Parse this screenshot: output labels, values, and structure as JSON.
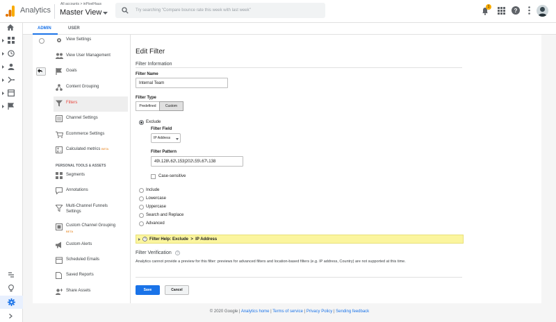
{
  "app": {
    "name": "Analytics",
    "breadcrumb": "All accounts > inPixelHaus",
    "view": "Master View",
    "search_placeholder": "Try searching \"Compare bounce rate this week with last week\"",
    "notification_count": "1"
  },
  "tabs": {
    "admin": "ADMIN",
    "user": "USER"
  },
  "nav": {
    "items": [
      {
        "label": "View Settings",
        "icon": "gear-icon"
      },
      {
        "label": "View User Management",
        "icon": "users-icon"
      },
      {
        "label": "Goals",
        "icon": "flag-icon"
      },
      {
        "label": "Content Grouping",
        "icon": "content-grouping-icon"
      },
      {
        "label": "Filters",
        "icon": "filter-icon"
      },
      {
        "label": "Channel Settings",
        "icon": "channel-icon"
      },
      {
        "label": "Ecommerce Settings",
        "icon": "cart-icon"
      },
      {
        "label": "Calculated metrics",
        "badge": "BETA",
        "icon": "calculator-icon"
      }
    ],
    "section_title": "PERSONAL TOOLS & ASSETS",
    "personal": [
      {
        "label": "Segments",
        "icon": "segments-icon"
      },
      {
        "label": "Annotations",
        "icon": "annotations-icon"
      },
      {
        "label": "Multi-Channel Funnels",
        "label2": "Settings",
        "icon": "funnel-icon"
      },
      {
        "label": "Custom Channel Grouping",
        "badge": "BETA",
        "icon": "grouping-icon"
      },
      {
        "label": "Custom Alerts",
        "icon": "megaphone-icon"
      },
      {
        "label": "Scheduled Emails",
        "icon": "schedule-icon"
      },
      {
        "label": "Saved Reports",
        "icon": "saved-reports-icon"
      },
      {
        "label": "Share Assets",
        "icon": "share-icon"
      }
    ],
    "active": "Filters"
  },
  "form": {
    "title": "Edit Filter",
    "section_info": "Filter Information",
    "name_label": "Filter Name",
    "name_value": "Internal Team",
    "type_label": "Filter Type",
    "type_predefined": "Predefined",
    "type_custom": "Custom",
    "options": {
      "exclude": "Exclude",
      "include": "Include",
      "lowercase": "Lowercase",
      "uppercase": "Uppercase",
      "search_replace": "Search and Replace",
      "advanced": "Advanced"
    },
    "selected_option": "Exclude",
    "field_label": "Filter Field",
    "field_value": "IP Address",
    "pattern_label": "Filter Pattern",
    "pattern_value": "49\\.128\\.62\\.153|202\\.55\\.67\\.138",
    "case_sensitive": "Case-sensitive",
    "help_text": "Filter Help: Exclude  >  IP Address",
    "verification_title": "Filter Verification",
    "verification_text": "Analytics cannot provide a preview for this filter: previews for advanced filters and location-based filters (e.g. IP address, Country) are not supported at this time.",
    "save": "Save",
    "cancel": "Cancel"
  },
  "footer": {
    "copyright": "© 2020 Google",
    "links": [
      "Analytics home",
      "Terms of service",
      "Privacy Policy",
      "Sending feedback"
    ]
  },
  "colors": {
    "accent": "#1a73e8",
    "active_red": "#e8453c",
    "help_yellow": "#fbf59e",
    "logo_orange": "#f9ab00",
    "logo_dark": "#e37400"
  }
}
